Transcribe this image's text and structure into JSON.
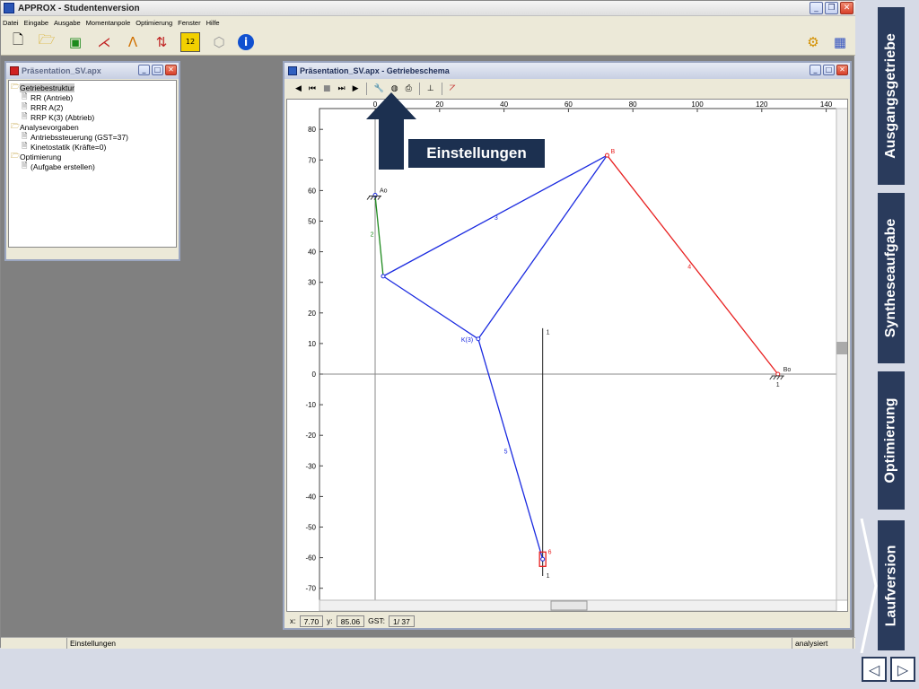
{
  "app": {
    "title": "APPROX - Studentenversion",
    "menu": [
      "Datei",
      "Eingabe",
      "Ausgabe",
      "Momentanpole",
      "Optimierung",
      "Fenster",
      "Hilfe"
    ]
  },
  "tree_window": {
    "title": "Präsentation_SV.apx",
    "nodes": [
      {
        "label": "Getriebestruktur",
        "folder": true,
        "level": 0
      },
      {
        "label": "RR (Antrieb)",
        "folder": false,
        "level": 1
      },
      {
        "label": "RRR A(2)",
        "folder": false,
        "level": 1
      },
      {
        "label": "RRP K(3) (Abtrieb)",
        "folder": false,
        "level": 1
      },
      {
        "label": "Analysevorgaben",
        "folder": true,
        "level": 0
      },
      {
        "label": "Antriebssteuerung (GST=37)",
        "folder": false,
        "level": 1
      },
      {
        "label": "Kinetostatik (Kräfte=0)",
        "folder": false,
        "level": 1
      },
      {
        "label": "Optimierung",
        "folder": true,
        "level": 0
      },
      {
        "label": "(Aufgabe erstellen)",
        "folder": false,
        "level": 1
      }
    ]
  },
  "plot_window": {
    "title": "Präsentation_SV.apx - Getriebeschema",
    "x_ticks": [
      "0",
      "20",
      "40",
      "60",
      "80",
      "100",
      "120",
      "140"
    ],
    "y_ticks": [
      "80",
      "70",
      "60",
      "50",
      "40",
      "30",
      "20",
      "10",
      "0",
      "-10",
      "-20",
      "-30",
      "-40",
      "-50",
      "-60",
      "-70"
    ],
    "points": {
      "A0": {
        "label": "Ao",
        "x": 0,
        "y": 58.5
      },
      "A": {
        "x": 2.5,
        "y": 32
      },
      "B": {
        "label": "B",
        "x": 72,
        "y": 71.5
      },
      "B0": {
        "label": "Bo",
        "x": 125,
        "y": 0
      },
      "K": {
        "label": "K(3)",
        "x": 32,
        "y": 11.5
      },
      "C": {
        "x": 52,
        "y": -60.5
      }
    },
    "link_labels": {
      "link2": "2",
      "link3": "3",
      "link4": "4",
      "link5": "5",
      "slider": "6",
      "guide_top": "1",
      "guide_bottom": "1",
      "ground_b0": "1"
    },
    "coords": {
      "x_label": "x:",
      "x": "7.70",
      "y_label": "y:",
      "y": "85.06",
      "gst_label": "GST:",
      "gst": "1/ 37"
    }
  },
  "callout": {
    "label": "Einstellungen"
  },
  "statusbar": {
    "hint": "Einstellungen",
    "state": "analysiert"
  },
  "sidenav": [
    "Ausgangsgetriebe",
    "Syntheseaufgabe",
    "Optimierung",
    "Laufversion"
  ],
  "colors": {
    "link_blue": "#1a2ae0",
    "link_red": "#e82020",
    "link_green": "#1e8a1e",
    "nav_dark": "#2a3b5c"
  }
}
